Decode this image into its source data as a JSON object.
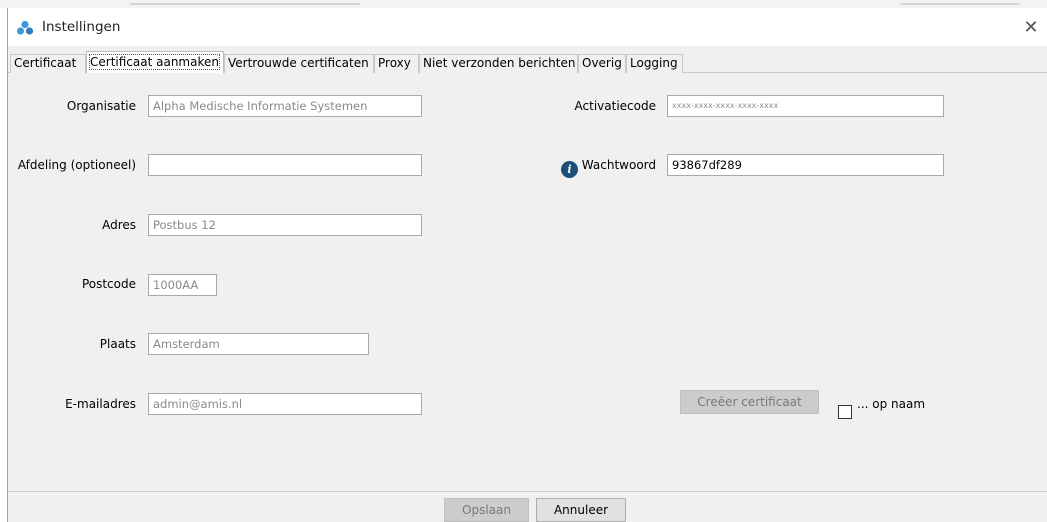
{
  "window": {
    "title": "Instellingen"
  },
  "tabs": [
    {
      "label": "Certificaat"
    },
    {
      "label": "Certificaat aanmaken"
    },
    {
      "label": "Vertrouwde certificaten"
    },
    {
      "label": "Proxy"
    },
    {
      "label": "Niet verzonden berichten"
    },
    {
      "label": "Overig"
    },
    {
      "label": "Logging"
    }
  ],
  "form": {
    "organisatie": {
      "label": "Organisatie",
      "placeholder": "Alpha Medische Informatie Systemen"
    },
    "afdeling": {
      "label": "Afdeling (optioneel)",
      "value": ""
    },
    "adres": {
      "label": "Adres",
      "placeholder": "Postbus 12"
    },
    "postcode": {
      "label": "Postcode",
      "placeholder": "1000AA"
    },
    "plaats": {
      "label": "Plaats",
      "placeholder": "Amsterdam"
    },
    "email": {
      "label": "E-mailadres",
      "placeholder": "admin@amis.nl"
    },
    "activatiecode": {
      "label": "Activatiecode",
      "placeholder": "xxxx-xxxx-xxxx-xxxx-xxxx"
    },
    "wachtwoord": {
      "label": "Wachtwoord",
      "value": "93867df289"
    }
  },
  "actions": {
    "create_label": "Creëer certificaat",
    "op_naam_label": "... op naam",
    "save_label": "Opslaan",
    "cancel_label": "Annuleer"
  },
  "icons": {
    "app": "settings-icon",
    "info": "info-icon",
    "close": "close-icon"
  },
  "colors": {
    "info_icon": "#1c4f7a",
    "app_icon": "#3a9ad9"
  }
}
